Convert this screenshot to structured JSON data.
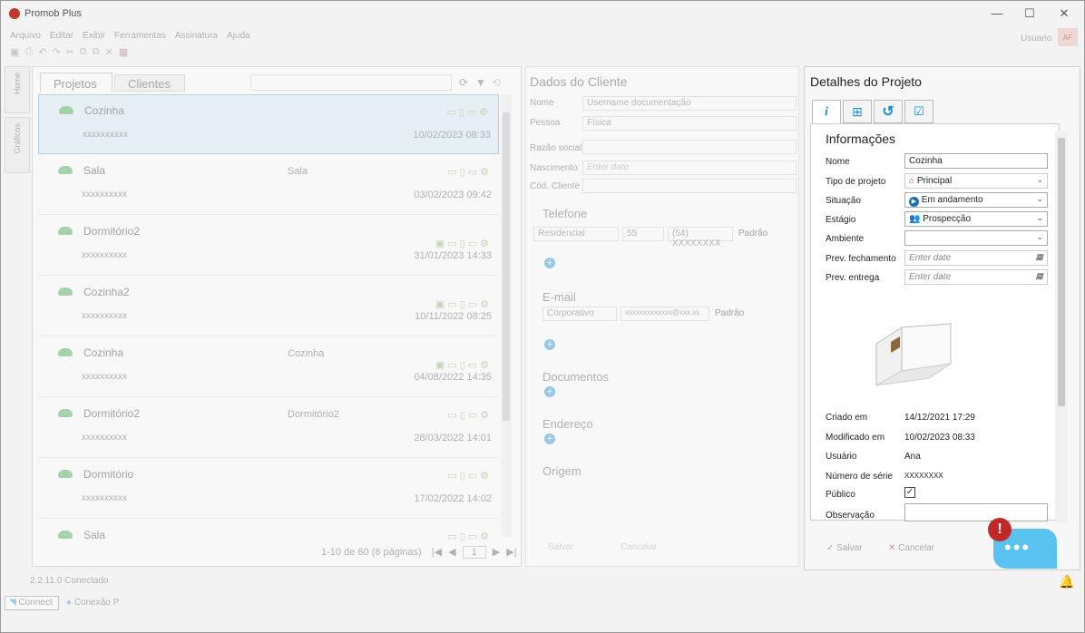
{
  "app": {
    "title": "Promob Plus"
  },
  "window_controls": {
    "minimize": "—",
    "maximize": "☐",
    "close": "✕"
  },
  "menu": [
    "Arquivo",
    "Editar",
    "Exibir",
    "Ferramentas",
    "Assinatura",
    "Ajuda"
  ],
  "user": {
    "name": "Usuario",
    "initials": "AF"
  },
  "side_tabs": {
    "home": "Home",
    "graficos": "Gráficos"
  },
  "projects": {
    "tab_projetos": "Projetos",
    "tab_clientes": "Clientes",
    "rows": [
      {
        "name": "Cozinha",
        "user": "xxxxxxxxxx",
        "env": "",
        "date": "10/02/2023 08:33"
      },
      {
        "name": "Sala",
        "user": "xxxxxxxxxx",
        "env": "Sala",
        "date": "03/02/2023 09:42"
      },
      {
        "name": "Dormitório2",
        "user": "xxxxxxxxxx",
        "env": "",
        "date": "31/01/2023 14:33"
      },
      {
        "name": "Cozinha2",
        "user": "xxxxxxxxxx",
        "env": "",
        "date": "10/11/2022 08:25"
      },
      {
        "name": "Cozinha",
        "user": "xxxxxxxxxx",
        "env": "Cozinha",
        "date": "04/08/2022 14:35"
      },
      {
        "name": "Dormitório2",
        "user": "xxxxxxxxxx",
        "env": "Dormitório2",
        "date": "28/03/2022 14:01"
      },
      {
        "name": "Dormitório",
        "user": "xxxxxxxxxx",
        "env": "",
        "date": "17/02/2022 14:02"
      },
      {
        "name": "Sala",
        "user": "",
        "env": "",
        "date": ""
      }
    ],
    "pager": "1-10 de 60 (6 páginas)",
    "page_number": "1"
  },
  "client": {
    "title": "Dados do Cliente",
    "nome_label": "Nome",
    "nome_value": "Username documentação",
    "pessoa_label": "Pessoa",
    "pessoa_value": "Física",
    "razao_label": "Razão social",
    "nascimento_label": "Nascimento",
    "nascimento_placeholder": "Enter date",
    "cod_label": "Cód. Cliente",
    "telefone": "Telefone",
    "telefone_tipo": "Residencial",
    "telefone_ddd": "55",
    "telefone_num": "(54) XXXXXXXX",
    "padrao": "Padrão",
    "email": "E-mail",
    "email_tipo": "Corporativo",
    "email_value": "xxxxxxxxxxxxx@xxx.xx",
    "documentos": "Documentos",
    "endereco": "Endereço",
    "origem": "Origem",
    "salvar": "Salvar",
    "cancelar": "Cancelar"
  },
  "details": {
    "title": "Detalhes do Projeto",
    "section": "Informações",
    "fields": {
      "nome_label": "Nome",
      "nome_value": "Cozinha",
      "tipo_label": "Tipo de projeto",
      "tipo_value": "Principal",
      "situacao_label": "Situação",
      "situacao_value": "Em andamento",
      "estagio_label": "Estágio",
      "estagio_value": "Prospecção",
      "ambiente_label": "Ambiente",
      "prev_fech_label": "Prev. fechamento",
      "prev_fech_placeholder": "Enter date",
      "prev_entrega_label": "Prev. entrega",
      "prev_entrega_placeholder": "Enter date",
      "criado_label": "Criado em",
      "criado_value": "14/12/2021 17:29",
      "modificado_label": "Modificado em",
      "modificado_value": "10/02/2023 08:33",
      "usuario_label": "Usuário",
      "usuario_value": "Ana",
      "serie_label": "Número de série",
      "serie_value": "XXXXXXXX",
      "publico_label": "Público",
      "observacao_label": "Observação"
    },
    "salvar": "Salvar",
    "cancelar": "Cancelar"
  },
  "status": {
    "version": "2.2.11.0 Conectado",
    "connect": "Connect",
    "conexao": "Conexão P"
  },
  "colors": {
    "accent": "#5ac2ef",
    "alert": "#c0282a",
    "cloud": "#3aa84a",
    "selection": "#d4eaf7"
  }
}
